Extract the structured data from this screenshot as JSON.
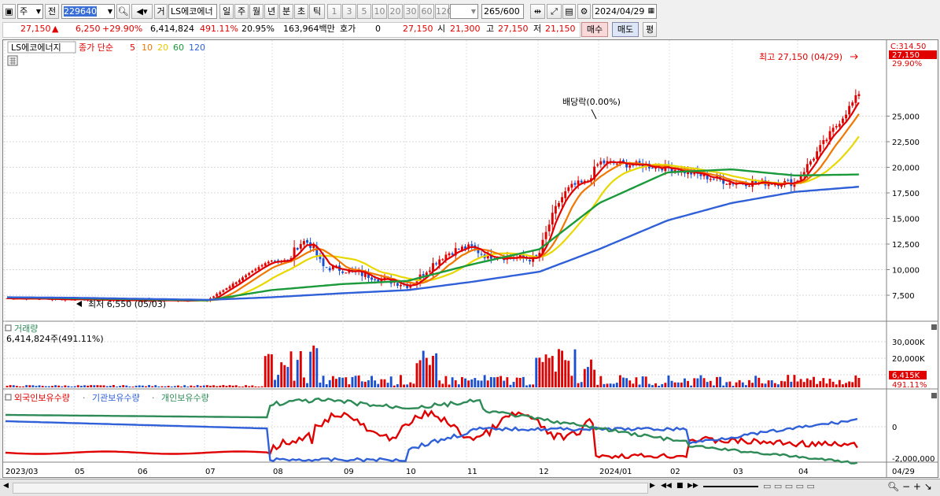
{
  "toolbar": {
    "market": "주",
    "prev_label": "전",
    "code": "229640",
    "category": "거",
    "stock_name": "LS에코에너",
    "periods": [
      "일",
      "주",
      "월",
      "년",
      "분",
      "초",
      "틱"
    ],
    "active_period": "일",
    "intervals": [
      "1",
      "3",
      "5",
      "10",
      "20",
      "30",
      "60",
      "120"
    ],
    "count_value": "265",
    "count_total": "/600",
    "date": "2024/04/29"
  },
  "quote": {
    "price": "27,150",
    "change": "6,250",
    "change_pct": "+29.90%",
    "volume": "6,414,824",
    "vol_pct": "491.11%",
    "turnover": "20.95%",
    "amount": "163,964백만",
    "bid_label": "호가",
    "bid_value": "0",
    "bid_price": "27,150",
    "open_label": "시",
    "open": "21,300",
    "high_label": "고",
    "high": "27,150",
    "low_label": "저",
    "low": "21,150",
    "buy_label": "매수",
    "sell_label": "매도",
    "eval_label": "평"
  },
  "price_panel": {
    "stock_name": "LS에코에너지",
    "ma_label": "종가 단순",
    "ma_periods": [
      {
        "label": "5",
        "color": "#e00000"
      },
      {
        "label": "10",
        "color": "#f07800"
      },
      {
        "label": "20",
        "color": "#e8d800"
      },
      {
        "label": "60",
        "color": "#1a9a3a"
      },
      {
        "label": "120",
        "color": "#3060d8"
      }
    ],
    "high_annotation": "최고 27,150 (04/29)",
    "low_annotation": "최저 6,550 (05/03)",
    "dividend_annotation": "배당락(0.00%)",
    "axis_top": "C:314.50",
    "current_price_tag": "27,150",
    "current_pct_tag": "29.90%",
    "y_ticks": [
      "25,000",
      "22,500",
      "20,000",
      "17,500",
      "15,000",
      "12,500",
      "10,000",
      "7,500"
    ]
  },
  "volume_panel": {
    "title": "거래량",
    "value": "6,414,824주(491.11%)",
    "y_ticks": [
      "30,000K",
      "20,000K",
      "10,000K"
    ],
    "current_tag": "6,415K",
    "current_pct": "491.11%"
  },
  "holdings_panel": {
    "labels": [
      {
        "label": "외국인보유수량",
        "color": "#e00000"
      },
      {
        "label": "기관보유수량",
        "color": "#3060d8"
      },
      {
        "label": "개인보유수량",
        "color": "#2e8b57"
      }
    ],
    "y_ticks": [
      "0",
      "-2,000,000"
    ]
  },
  "x_axis": [
    "2023/03",
    "05",
    "06",
    "07",
    "08",
    "09",
    "10",
    "11",
    "12",
    "2024/01",
    "02",
    "03",
    "04"
  ],
  "x_axis_last": "04/29",
  "colors": {
    "up": "#e00000",
    "down": "#1a4fd0",
    "ma5": "#e00000",
    "ma10": "#f07800",
    "ma20": "#e8d800",
    "ma60": "#1a9a3a",
    "ma120": "#3060d8"
  },
  "chart_data": {
    "type": "line",
    "title": "LS에코에너지",
    "ylim": [
      6000,
      27500
    ],
    "x": [
      "2023/03",
      "05",
      "06",
      "07",
      "08",
      "09",
      "10",
      "11",
      "12",
      "2024/01",
      "02",
      "03",
      "04",
      "04/29"
    ],
    "series": [
      {
        "name": "종가",
        "values": [
          7200,
          7100,
          7000,
          7000,
          11000,
          10000,
          8500,
          11500,
          11000,
          20500,
          20000,
          18500,
          18500,
          27150
        ]
      },
      {
        "name": "60",
        "values": [
          7300,
          7200,
          7100,
          7000,
          8000,
          8600,
          8900,
          10500,
          12000,
          16500,
          19500,
          19800,
          19200,
          19300
        ]
      },
      {
        "name": "120",
        "values": [
          7300,
          7250,
          7150,
          7050,
          7300,
          7700,
          8000,
          8800,
          9800,
          12000,
          14800,
          16500,
          17600,
          18100
        ]
      }
    ]
  }
}
